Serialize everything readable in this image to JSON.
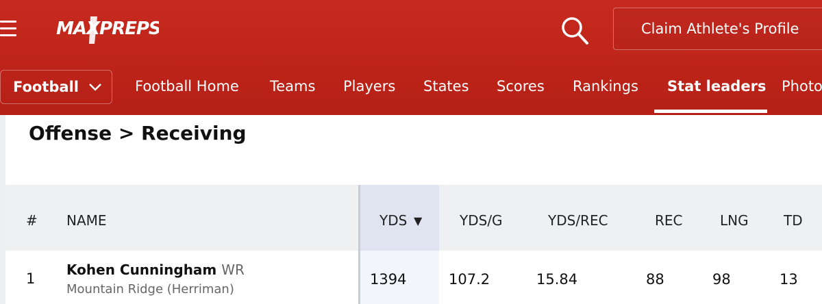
{
  "header": {
    "brand": "MAXPREPS",
    "claim_button": "Claim Athlete's Profile",
    "colors": {
      "primary_red": "#c0281d",
      "white": "#ffffff"
    }
  },
  "nav": {
    "sport": "Football",
    "items": [
      {
        "label": "Football Home"
      },
      {
        "label": "Teams"
      },
      {
        "label": "Players"
      },
      {
        "label": "States"
      },
      {
        "label": "Scores"
      },
      {
        "label": "Rankings"
      },
      {
        "label": "Stat leaders",
        "active": true
      },
      {
        "label": "Photo"
      }
    ]
  },
  "page": {
    "breadcrumb": "Offense > Receiving"
  },
  "table": {
    "headers": {
      "rank": "#",
      "name": "NAME",
      "yds": "YDS",
      "yds_sort": "▼",
      "yds_g": "YDS/G",
      "yds_rec": "YDS/REC",
      "rec": "REC",
      "lng": "LNG",
      "td": "TD"
    },
    "rows": [
      {
        "rank": "1",
        "name": "Kohen Cunningham",
        "position": "WR",
        "school": "Mountain Ridge (Herriman)",
        "yds": "1394",
        "yds_g": "107.2",
        "yds_rec": "15.84",
        "rec": "88",
        "lng": "98",
        "td": "13"
      }
    ]
  }
}
